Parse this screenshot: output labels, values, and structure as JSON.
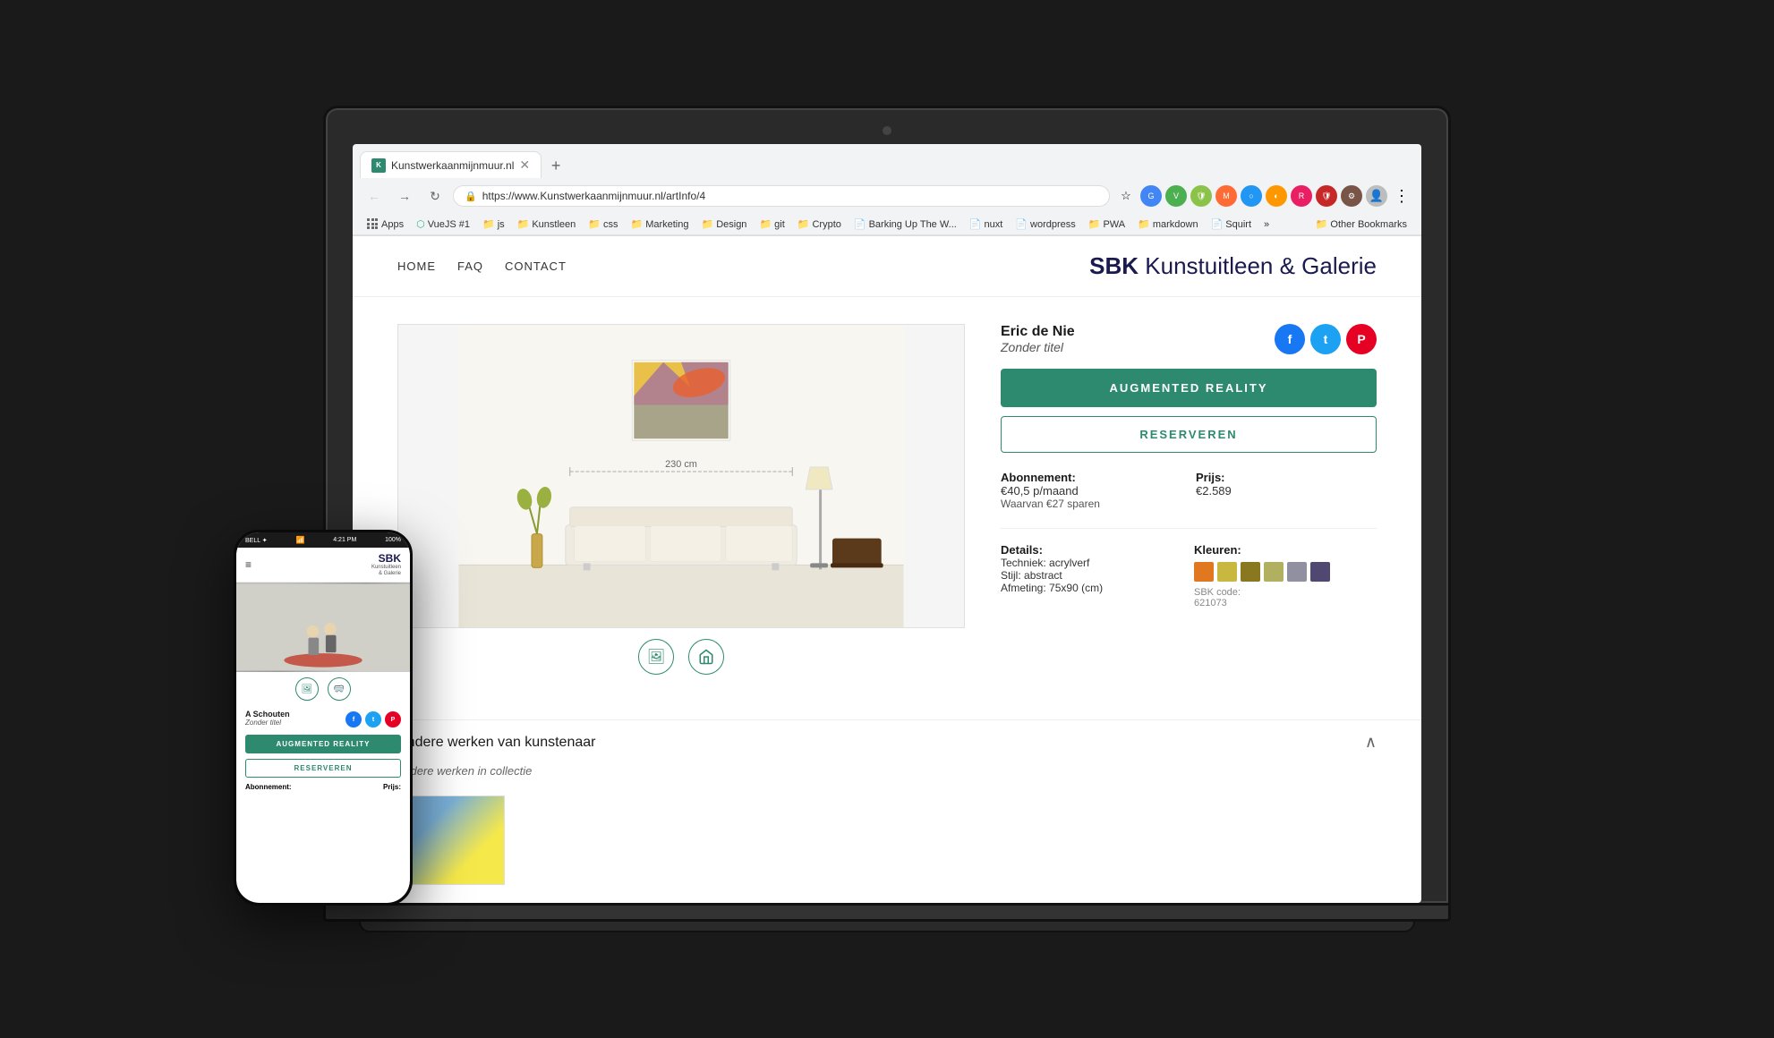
{
  "laptop": {
    "camera_label": "camera"
  },
  "browser": {
    "tab_title": "Kunstwerkaanmijnmuur.nl",
    "url": "https://www.Kunstwerkaanmijnmuur.nl/artInfo/4",
    "new_tab_icon": "+",
    "back_icon": "←",
    "forward_icon": "→",
    "refresh_icon": "↻",
    "lock_icon": "🔒",
    "more_icon": "⋮",
    "star_icon": "☆"
  },
  "bookmarks": [
    {
      "label": "Apps",
      "type": "apps"
    },
    {
      "label": "VueJS #1",
      "type": "folder",
      "icon": "🟢"
    },
    {
      "label": "js",
      "type": "folder"
    },
    {
      "label": "Kunstleen",
      "type": "folder"
    },
    {
      "label": "css",
      "type": "folder"
    },
    {
      "label": "Marketing",
      "type": "folder"
    },
    {
      "label": "Design",
      "type": "folder"
    },
    {
      "label": "git",
      "type": "folder"
    },
    {
      "label": "Crypto",
      "type": "folder"
    },
    {
      "label": "Barking Up The W...",
      "type": "page"
    },
    {
      "label": "nuxt",
      "type": "page"
    },
    {
      "label": "wordpress",
      "type": "page"
    },
    {
      "label": "PWA",
      "type": "folder"
    },
    {
      "label": "markdown",
      "type": "folder"
    },
    {
      "label": "Squirt",
      "type": "page"
    },
    {
      "label": "»",
      "type": "more"
    },
    {
      "label": "Other Bookmarks",
      "type": "folder"
    }
  ],
  "site": {
    "nav": {
      "home": "HOME",
      "faq": "FAQ",
      "contact": "CONTACT"
    },
    "logo_brand": "SBK",
    "logo_text": "Kunstuitleen & Galerie",
    "artist_name": "Eric de Nie",
    "artwork_title": "Zonder titel",
    "btn_ar": "AUGMENTED REALITY",
    "btn_reserve": "RESERVEREN",
    "subscription_label": "Abonnement:",
    "subscription_value": "€40,5 p/maand",
    "subscription_sub": "Waarvan €27 sparen",
    "price_label": "Prijs:",
    "price_value": "€2.589",
    "details_label": "Details:",
    "technique_label": "Techniek:",
    "technique_value": "acrylverf",
    "style_label": "Stijl:",
    "style_value": "abstract",
    "size_label": "Afmeting:",
    "size_value": "75x90 (cm)",
    "colors_label": "Kleuren:",
    "colors": [
      "#e07820",
      "#c8b840",
      "#8a7820",
      "#b0b060",
      "#9090a0",
      "#504870"
    ],
    "sbk_code_label": "SBK code:",
    "sbk_code_value": "621073",
    "dimension_label": "230 cm",
    "accordion_title": "Andere werken van kunstenaar",
    "accordion_sub": "andere werken in collectie",
    "accordion_chevron": "∧"
  },
  "phone": {
    "status_time": "4:21 PM",
    "status_carrier": "BELL ✦",
    "status_battery": "100%",
    "header_menu": "≡",
    "logo": "SBK",
    "logo_sub": "Kunstuitleen\n& Galerie",
    "artist": "A Schouten",
    "title": "Zonder titel",
    "btn_ar": "AUGMENTED REALITY",
    "btn_reserve": "RESERVEREN",
    "subscription_label": "Abonnement:",
    "price_label": "Prijs:"
  }
}
